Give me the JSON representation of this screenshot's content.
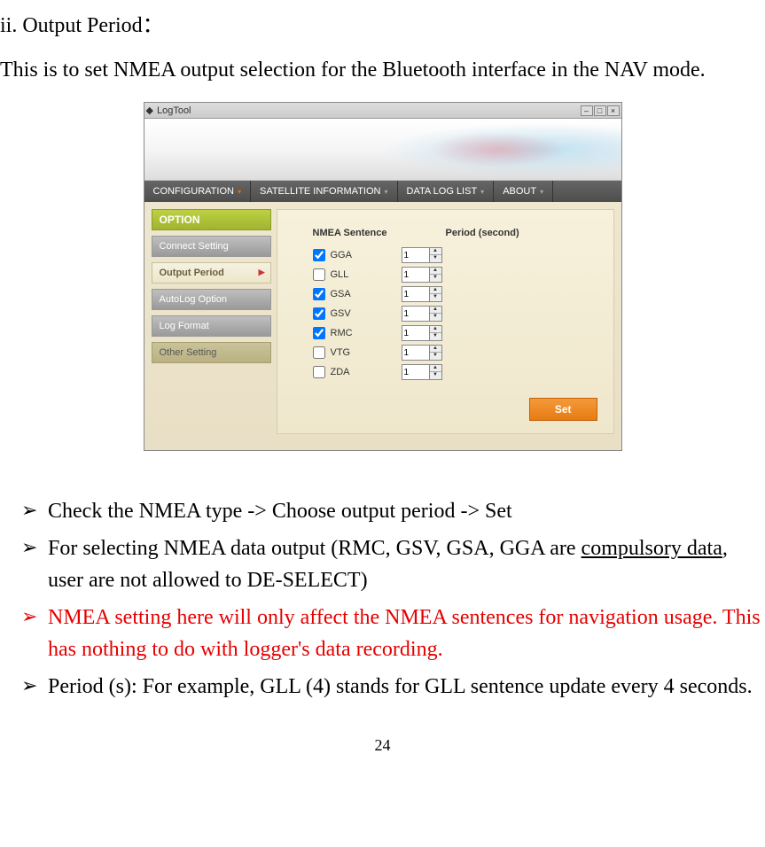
{
  "heading": "ii. Output Period：",
  "intro": "This is to set NMEA output selection for the Bluetooth interface in the NAV mode.",
  "logtool": {
    "title": "LogTool",
    "navtabs": [
      "CONFIGURATION",
      "SATELLITE  INFORMATION",
      "DATA  LOG  LIST",
      "ABOUT"
    ],
    "sidebar_head": "OPTION",
    "sidebar": [
      "Connect  Setting",
      "Output  Period",
      "AutoLog  Option",
      "Log  Format",
      "Other  Setting"
    ],
    "col1": "NMEA Sentence",
    "col2": "Period (second)",
    "rows": [
      {
        "label": "GGA",
        "checked": true,
        "period": "1"
      },
      {
        "label": "GLL",
        "checked": false,
        "period": "1"
      },
      {
        "label": "GSA",
        "checked": true,
        "period": "1"
      },
      {
        "label": "GSV",
        "checked": true,
        "period": "1"
      },
      {
        "label": "RMC",
        "checked": true,
        "period": "1"
      },
      {
        "label": "VTG",
        "checked": false,
        "period": "1"
      },
      {
        "label": "ZDA",
        "checked": false,
        "period": "1"
      }
    ],
    "set_label": "Set"
  },
  "bullets": {
    "b1": "Check the NMEA type -> Choose output period -> Set",
    "b2a": "For selecting NMEA data output (RMC, GSV, GSA, GGA are ",
    "b2u": "compulsory data",
    "b2b": ", user are not allowed to DE-SELECT)",
    "b3": "NMEA setting here will only affect the NMEA sentences for navigation usage. This has nothing to do with logger's data recording.",
    "b4": "Period (s): For example, GLL (4) stands for GLL sentence update every 4 seconds."
  },
  "page_num": "24"
}
